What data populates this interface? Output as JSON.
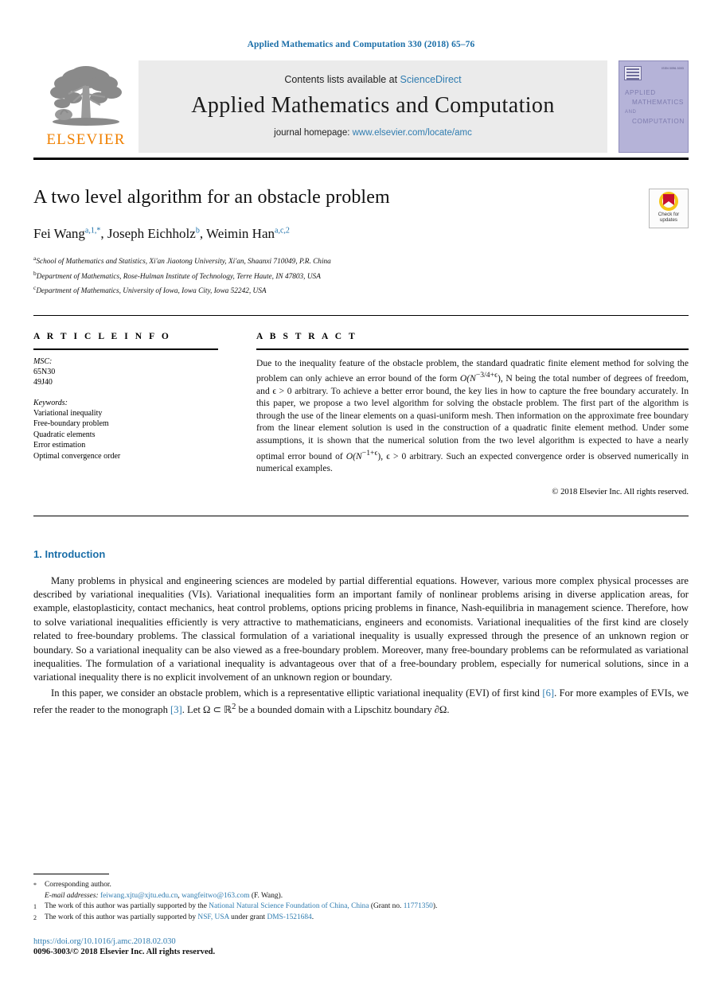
{
  "running_head": "Applied Mathematics and Computation 330 (2018) 65–76",
  "masthead": {
    "contents_prefix": "Contents lists available at ",
    "contents_link": "ScienceDirect",
    "journal_name": "Applied Mathematics and Computation",
    "homepage_prefix": "journal homepage: ",
    "homepage_link": "www.elsevier.com/locate/amc",
    "publisher_wordmark": "ELSEVIER",
    "cover": {
      "issn": "ISSN 0096-3003",
      "line1": "APPLIED",
      "line2": "MATHEMATICS",
      "line3": "AND",
      "line4": "COMPUTATION"
    }
  },
  "article": {
    "title": "A two level algorithm for an obstacle problem",
    "authors": [
      {
        "name": "Fei Wang",
        "sup": "a,1,*"
      },
      {
        "name": "Joseph Eichholz",
        "sup": "b"
      },
      {
        "name": "Weimin Han",
        "sup": "a,c,2"
      }
    ],
    "affiliations": [
      {
        "marker": "a",
        "text": "School of Mathematics and Statistics, Xi'an Jiaotong University, Xi'an, Shaanxi 710049, P.R. China"
      },
      {
        "marker": "b",
        "text": "Department of Mathematics, Rose-Hulman Institute of Technology, Terre Haute, IN 47803, USA"
      },
      {
        "marker": "c",
        "text": "Department of Mathematics, University of Iowa, Iowa City, Iowa 52242, USA"
      }
    ],
    "crossmark": {
      "line1": "Check for",
      "line2": "updates"
    }
  },
  "article_info": {
    "heading": "A R T I C L E   I N F O",
    "msc_label": "MSC:",
    "msc_codes": [
      "65N30",
      "49J40"
    ],
    "keywords_label": "Keywords:",
    "keywords": [
      "Variational inequality",
      "Free-boundary problem",
      "Quadratic elements",
      "Error estimation",
      "Optimal convergence order"
    ]
  },
  "abstract": {
    "heading": "A B S T R A C T",
    "part1": "Due to the inequality feature of the obstacle problem, the standard quadratic finite element method for solving the problem can only achieve an error bound of the form ",
    "math1": "O(N",
    "math1_sup": "−3/4+ϵ",
    "part2": "), N being the total number of degrees of freedom, and ϵ > 0 arbitrary. To achieve a better error bound, the key lies in how to capture the free boundary accurately. In this paper, we propose a two level algorithm for solving the obstacle problem. The first part of the algorithm is through the use of the linear elements on a quasi-uniform mesh. Then information on the approximate free boundary from the linear element solution is used in the construction of a quadratic finite element method. Under some assumptions, it is shown that the numerical solution from the two level algorithm is expected to have a nearly optimal error bound of ",
    "math2": "O(N",
    "math2_sup": "−1+ϵ",
    "part3": "), ϵ > 0 arbitrary. Such an expected convergence order is observed numerically in numerical examples.",
    "copyright": "© 2018 Elsevier Inc. All rights reserved."
  },
  "introduction": {
    "heading": "1. Introduction",
    "paragraph1": "Many problems in physical and engineering sciences are modeled by partial differential equations. However, various more complex physical processes are described by variational inequalities (VIs). Variational inequalities form an important family of nonlinear problems arising in diverse application areas, for example, elastoplasticity, contact mechanics, heat control problems, options pricing problems in finance, Nash-equilibria in management science. Therefore, how to solve variational inequalities efficiently is very attractive to mathematicians, engineers and economists. Variational inequalities of the first kind are closely related to free-boundary problems. The classical formulation of a variational inequality is usually expressed through the presence of an unknown region or boundary. So a variational inequality can be also viewed as a free-boundary problem. Moreover, many free-boundary problems can be reformulated as variational inequalities. The formulation of a variational inequality is advantageous over that of a free-boundary problem, especially for numerical solutions, since in a variational inequality there is no explicit involvement of an unknown region or boundary.",
    "paragraph2_a": "In this paper, we consider an obstacle problem, which is a representative elliptic variational inequality (EVI) of first kind ",
    "paragraph2_ref1": "[6]",
    "paragraph2_b": ". For more examples of EVIs, we refer the reader to the monograph ",
    "paragraph2_ref2": "[3]",
    "paragraph2_c": ". Let Ω ⊂ ℝ",
    "paragraph2_sup": "2",
    "paragraph2_d": " be a bounded domain with a Lipschitz boundary ∂Ω."
  },
  "footnotes": {
    "corresponding": "Corresponding author.",
    "email_label": "E-mail addresses:",
    "email1": "feiwang.xjtu@xjtu.edu.cn",
    "email2": "wangfeitwo@163.com",
    "email_owner": "(F. Wang).",
    "fn1_a": "The work of this author was partially supported by the ",
    "fn1_link": "National Natural Science Foundation of China, China",
    "fn1_b": " (Grant no. ",
    "fn1_grant": "11771350",
    "fn1_c": ").",
    "fn2_a": "The work of this author was partially supported by ",
    "fn2_link": "NSF, USA",
    "fn2_b": " under grant ",
    "fn2_grant": "DMS-1521684",
    "fn2_c": "."
  },
  "bottom": {
    "doi": "https://doi.org/10.1016/j.amc.2018.02.030",
    "issn_line": "0096-3003/© 2018 Elsevier Inc. All rights reserved."
  },
  "colors": {
    "link": "#2f7cb0",
    "heading_blue": "#1a6ea8",
    "elsevier_orange": "#f08000",
    "cover_purple": "#b5b3d8"
  }
}
